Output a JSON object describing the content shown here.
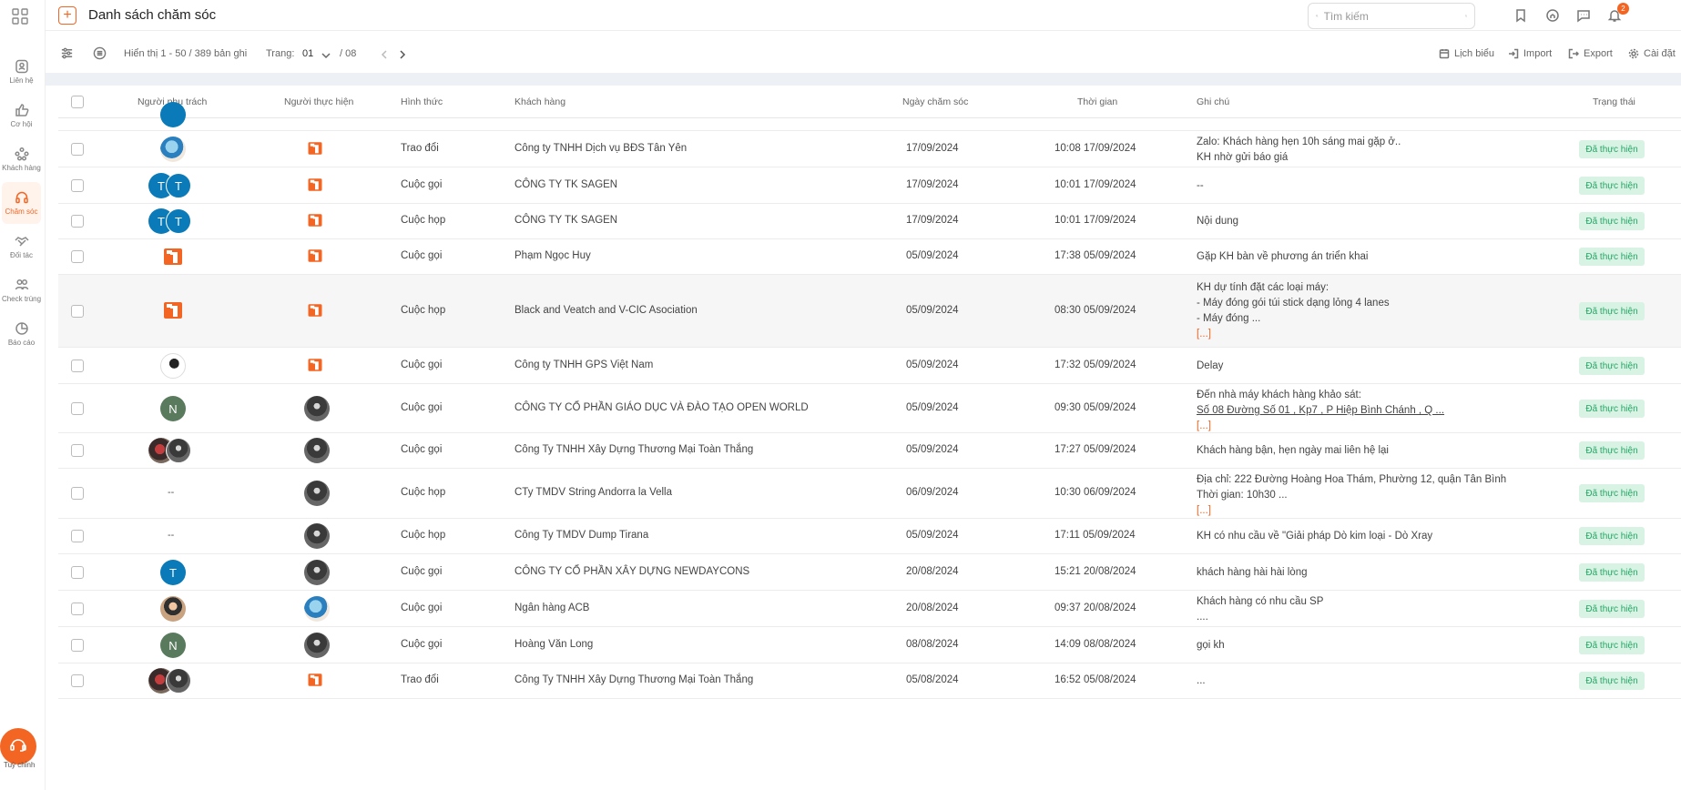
{
  "brand": {
    "accent": "#f26522",
    "status_bg": "#d8f3e4",
    "status_fg": "#24a564"
  },
  "sidebar": {
    "items": [
      {
        "label": "Liên hệ",
        "icon": "contact-icon"
      },
      {
        "label": "Cơ hội",
        "icon": "opportunity-icon"
      },
      {
        "label": "Khách hàng",
        "icon": "customers-icon"
      },
      {
        "label": "Chăm sóc",
        "icon": "headset-icon"
      },
      {
        "label": "Đối tác",
        "icon": "partner-icon"
      },
      {
        "label": "Check trùng",
        "icon": "duplicate-check-icon"
      },
      {
        "label": "Báo cáo",
        "icon": "report-icon"
      }
    ],
    "help_label": "Tuỳ chỉnh"
  },
  "header": {
    "title": "Danh sách chăm sóc",
    "search_placeholder": "Tìm kiếm",
    "notification_count": "2"
  },
  "toolbar": {
    "display_info": "Hiển thị 1 - 50 / 389 bản ghi",
    "page_label": "Trang:",
    "current_page": "01",
    "total_pages": "/ 08",
    "calendar": "Lịch biểu",
    "import": "Import",
    "export": "Export",
    "settings": "Cài đặt"
  },
  "table": {
    "headers": {
      "owner": "Người phụ trách",
      "performer": "Người thực hiện",
      "type": "Hình thức",
      "customer": "Khách hàng",
      "care_date": "Ngày chăm sóc",
      "time": "Thời gian",
      "note": "Ghi chú",
      "status": "Trạng thái"
    },
    "rows": [
      {
        "type": "Trao đổi",
        "customer": "Công ty TNHH Dịch vụ BĐS Tân Yên",
        "date": "17/09/2024",
        "time": "10:08 17/09/2024",
        "note1": "Zalo: Khách hàng hẹn 10h sáng mai gặp ở..",
        "note2": "KH nhờ gửi báo giá",
        "status": "Đã thực hiện"
      },
      {
        "type": "Cuộc gọi",
        "customer": "CÔNG TY TK SAGEN",
        "date": "17/09/2024",
        "time": "10:01 17/09/2024",
        "note1": "--",
        "status": "Đã thực hiện",
        "owner_initials": [
          "T",
          "T"
        ]
      },
      {
        "type": "Cuộc họp",
        "customer": "CÔNG TY TK SAGEN",
        "date": "17/09/2024",
        "time": "10:01 17/09/2024",
        "note1": "Nội dung",
        "status": "Đã thực hiện",
        "owner_initials": [
          "T",
          "T"
        ]
      },
      {
        "type": "Cuộc gọi",
        "customer": "Phạm Ngọc Huy",
        "date": "05/09/2024",
        "time": "17:38 05/09/2024",
        "note1": "Gặp KH bàn về phương án triển khai",
        "status": "Đã thực hiện"
      },
      {
        "type": "Cuộc họp",
        "customer": "Black and Veatch and V-CIC Asociation",
        "date": "05/09/2024",
        "time": "08:30 05/09/2024",
        "note1": "KH dự tính đặt các loại máy:",
        "note2": "- Máy đóng gói túi stick dạng lỏng 4 lanes",
        "note3": "- Máy đóng ...",
        "more": "[...]",
        "status": "Đã thực hiện"
      },
      {
        "type": "Cuộc gọi",
        "customer": "Công ty TNHH GPS Việt Nam",
        "date": "05/09/2024",
        "time": "17:32 05/09/2024",
        "note1": "Delay",
        "status": "Đã thực hiện"
      },
      {
        "type": "Cuộc gọi",
        "customer": "CÔNG TY CỔ PHẦN GIÁO DỤC VÀ ĐÀO TẠO OPEN WORLD",
        "date": "05/09/2024",
        "time": "09:30 05/09/2024",
        "note1": "Đến nhà máy khách hàng khảo sát:",
        "note2": "Số 08 Đường Số 01 , Kp7 , P Hiệp Bình Chánh , Q ...",
        "more": "[...]",
        "status": "Đã thực hiện",
        "owner_initials": [
          "N"
        ]
      },
      {
        "type": "Cuộc gọi",
        "customer": "Công Ty TNHH Xây Dựng Thương Mại Toàn Thắng",
        "date": "05/09/2024",
        "time": "17:27 05/09/2024",
        "note1": "Khách hàng bận, hẹn ngày mai liên hệ lại",
        "status": "Đã thực hiện"
      },
      {
        "type": "Cuộc họp",
        "customer": "CTy TMDV String Andorra la Vella",
        "date": "06/09/2024",
        "time": "10:30 06/09/2024",
        "note1": "Địa chỉ: 222 Đường Hoàng Hoa Thám, Phường 12, quận Tân Bình",
        "note2": "Thời gian: 10h30 ...",
        "more": "[...]",
        "status": "Đã thực hiện",
        "owner_text": "--"
      },
      {
        "type": "Cuộc họp",
        "customer": "Công Ty TMDV Dump Tirana",
        "date": "05/09/2024",
        "time": "17:11 05/09/2024",
        "note1": "KH có nhu cầu về \"Giải pháp Dò kim loại - Dò Xray",
        "status": "Đã thực hiện",
        "owner_text": "--"
      },
      {
        "type": "Cuộc gọi",
        "customer": "CÔNG TY CỔ PHẦN XÂY DỰNG NEWDAYCONS",
        "date": "20/08/2024",
        "time": "15:21 20/08/2024",
        "note1": "khách hàng hài hài lòng",
        "status": "Đã thực hiện",
        "owner_initials": [
          "T"
        ]
      },
      {
        "type": "Cuộc gọi",
        "customer": "Ngân hàng ACB",
        "date": "20/08/2024",
        "time": "09:37 20/08/2024",
        "note1": "Khách hàng có nhu cầu SP",
        "note2": "....",
        "status": "Đã thực hiện"
      },
      {
        "type": "Cuộc gọi",
        "customer": "Hoàng Văn Long",
        "date": "08/08/2024",
        "time": "14:09 08/08/2024",
        "note1": "gọi kh",
        "status": "Đã thực hiện",
        "owner_initials": [
          "N"
        ]
      },
      {
        "type": "Trao đổi",
        "customer": "Công Ty TNHH Xây Dựng Thương Mại Toàn Thắng",
        "date": "05/08/2024",
        "time": "16:52 05/08/2024",
        "note1": "...",
        "status": "Đã thực hiện"
      }
    ]
  }
}
